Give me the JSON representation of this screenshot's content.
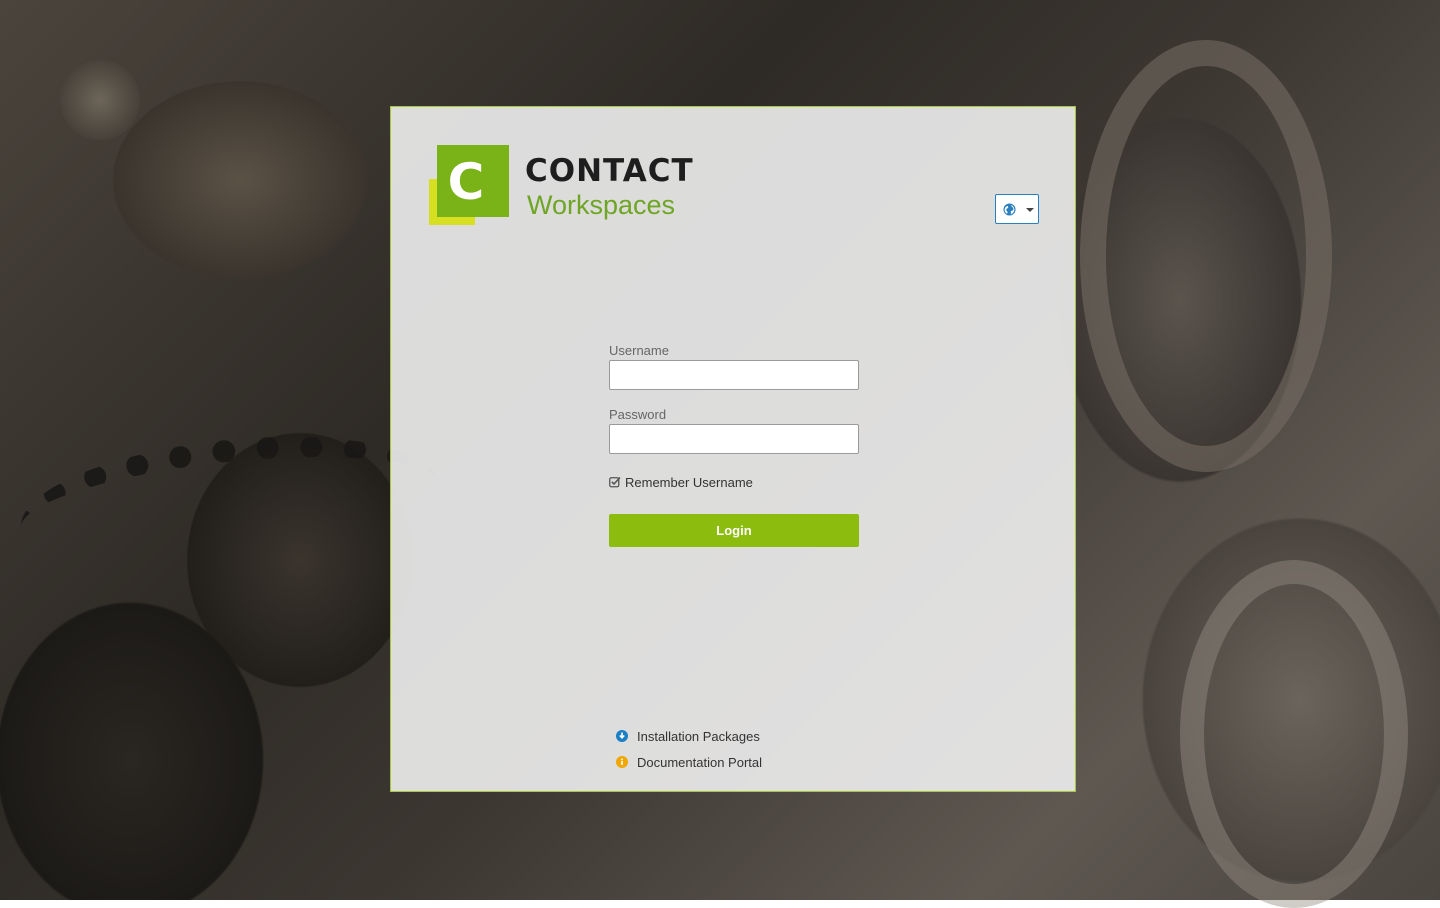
{
  "brand": {
    "name": "CONTACT",
    "product": "Workspaces",
    "letter": "C",
    "colors": {
      "green": "#7ab317",
      "yellow": "#d7df23",
      "accent": "#8cbd0e"
    }
  },
  "language": {
    "icon": "globe-icon",
    "caret_icon": "caret-down-icon"
  },
  "form": {
    "username_label": "Username",
    "username_value": "",
    "password_label": "Password",
    "password_value": "",
    "remember_label": "Remember Username",
    "remember_checked": true,
    "login_label": "Login"
  },
  "links": [
    {
      "label": "Installation Packages",
      "icon": "download-icon",
      "color": "#1a7fc4"
    },
    {
      "label": "Documentation Portal",
      "icon": "info-icon",
      "color": "#f0a800"
    }
  ]
}
